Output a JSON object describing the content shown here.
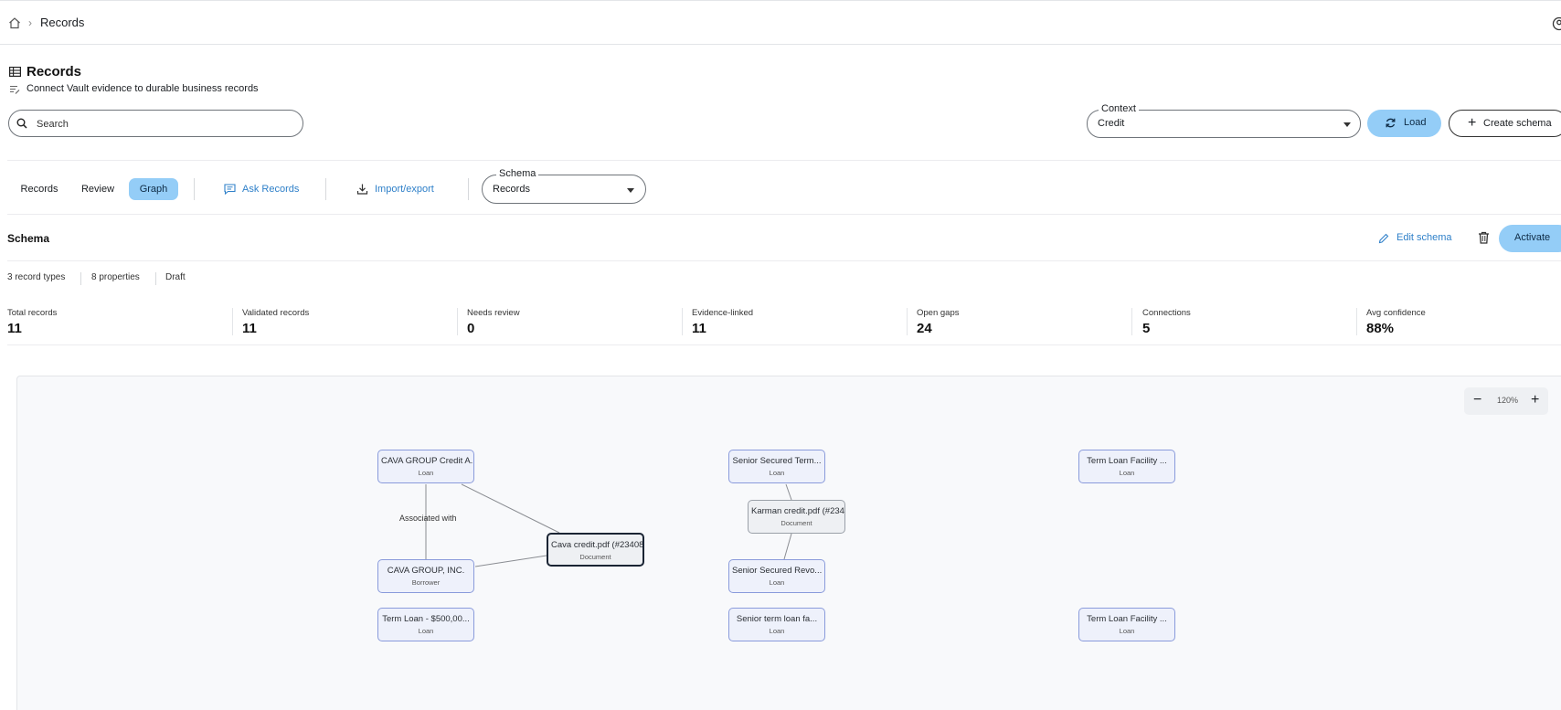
{
  "breadcrumb": {
    "current": "Records"
  },
  "page": {
    "title": "Records",
    "subtitle": "Connect Vault evidence to durable business records"
  },
  "search": {
    "placeholder": "Search"
  },
  "context": {
    "label": "Context",
    "value": "Credit"
  },
  "actions": {
    "load": "Load",
    "create_schema": "Create schema"
  },
  "tabs": [
    {
      "label": "Records",
      "active": false
    },
    {
      "label": "Review",
      "active": false
    },
    {
      "label": "Graph",
      "active": true
    }
  ],
  "tools": {
    "ask_records": "Ask Records",
    "import_export": "Import/export"
  },
  "schema_select": {
    "label": "Schema",
    "value": "Records"
  },
  "schema": {
    "title": "Schema",
    "edit": "Edit schema",
    "activate": "Activate",
    "meta": [
      "3 record types",
      "8 properties",
      "Draft"
    ]
  },
  "stats": [
    {
      "label": "Total records",
      "value": "11"
    },
    {
      "label": "Validated records",
      "value": "11"
    },
    {
      "label": "Needs review",
      "value": "0"
    },
    {
      "label": "Evidence-linked",
      "value": "11"
    },
    {
      "label": "Open gaps",
      "value": "24"
    },
    {
      "label": "Connections",
      "value": "5"
    },
    {
      "label": "Avg confidence",
      "value": "88%"
    }
  ],
  "graph": {
    "zoom": "120%",
    "edge_labels": [
      "Associated with"
    ],
    "nodes": [
      {
        "title": "CAVA GROUP Credit A...",
        "type": "Loan"
      },
      {
        "title": "Senior Secured Term...",
        "type": "Loan"
      },
      {
        "title": "Term Loan Facility ...",
        "type": "Loan"
      },
      {
        "title": "Karman credit.pdf (#234...",
        "type": "Document"
      },
      {
        "title": "Cava credit.pdf (#23408)",
        "type": "Document",
        "selected": true
      },
      {
        "title": "CAVA GROUP, INC.",
        "type": "Borrower"
      },
      {
        "title": "Senior Secured Revo...",
        "type": "Loan"
      },
      {
        "title": "Term Loan - $500,00...",
        "type": "Loan"
      },
      {
        "title": "Senior term loan fa...",
        "type": "Loan"
      },
      {
        "title": "Term Loan Facility ...",
        "type": "Loan"
      }
    ]
  }
}
